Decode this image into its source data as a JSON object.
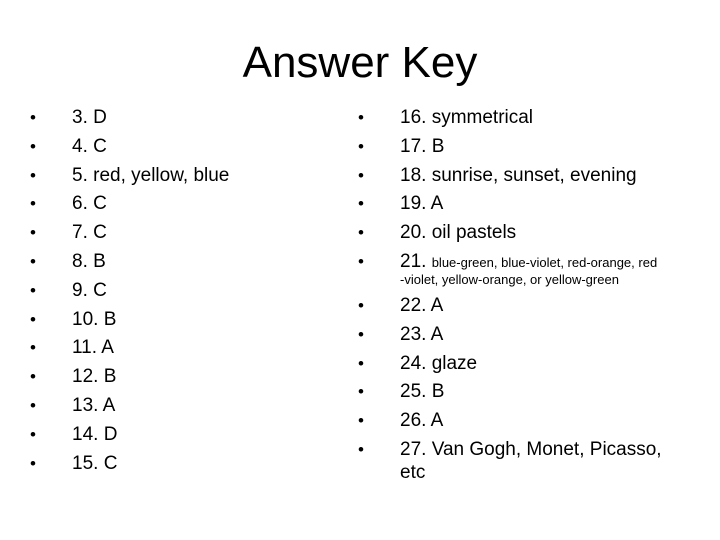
{
  "title": "Answer Key",
  "left_items": [
    "3. D",
    "4. C",
    "5. red, yellow, blue",
    "6. C",
    "7. C",
    "8. B",
    "9. C",
    "10. B",
    "11. A",
    "12. B",
    "13. A",
    "14. D",
    "15. C"
  ],
  "right_items": [
    "16. symmetrical",
    "17. B",
    "18. sunrise, sunset, evening",
    "19. A",
    "20. oil pastels"
  ],
  "item21": {
    "num": "21.",
    "line1": "blue-green, blue-violet, red-orange, red",
    "line2": "-violet, yellow-orange, or yellow-green"
  },
  "right_items2": [
    "22. A",
    "23. A",
    "24. glaze",
    "25. B",
    "26. A",
    "27. Van Gogh, Monet, Picasso,"
  ],
  "item27_cont": "etc",
  "bullet": "•"
}
